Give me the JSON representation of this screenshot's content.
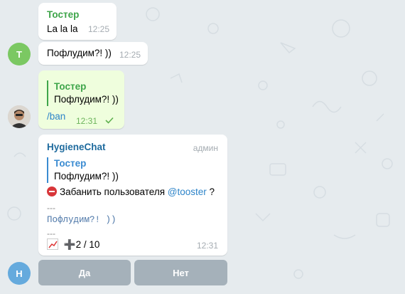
{
  "colors": {
    "background": "#e6ebee",
    "incoming_bubble": "#ffffff",
    "outgoing_bubble": "#effedd",
    "sender_green": "#3ea54a",
    "link_blue": "#2d84c9",
    "keyboard_button": "#a5b1ba"
  },
  "messages": {
    "m1": {
      "sender": "Тостер",
      "text": "La la la",
      "time": "12:25"
    },
    "m2": {
      "avatar": "T",
      "text": "Пофлудим?! ))",
      "time": "12:25"
    },
    "m3": {
      "reply_name": "Тостер",
      "reply_text": "Пофлудим?! ))",
      "text": "/ban",
      "time": "12:31",
      "status_icon": "checkmark-icon"
    },
    "m4": {
      "sender": "HygieneChat",
      "badge": "админ",
      "reply_name": "Тостер",
      "reply_text": "Пофлудим?! ))",
      "line1_text": "Забанить пользователя ",
      "mention": "@tooster",
      "line1_tail": " ?",
      "sep1": "---",
      "quoted": "Пофлудим?! ))",
      "sep2": "---",
      "votes": "➕2 / 10",
      "time": "12:31"
    }
  },
  "bot_avatar": "H",
  "keyboard": {
    "yes": "Да",
    "no": "Нет"
  }
}
